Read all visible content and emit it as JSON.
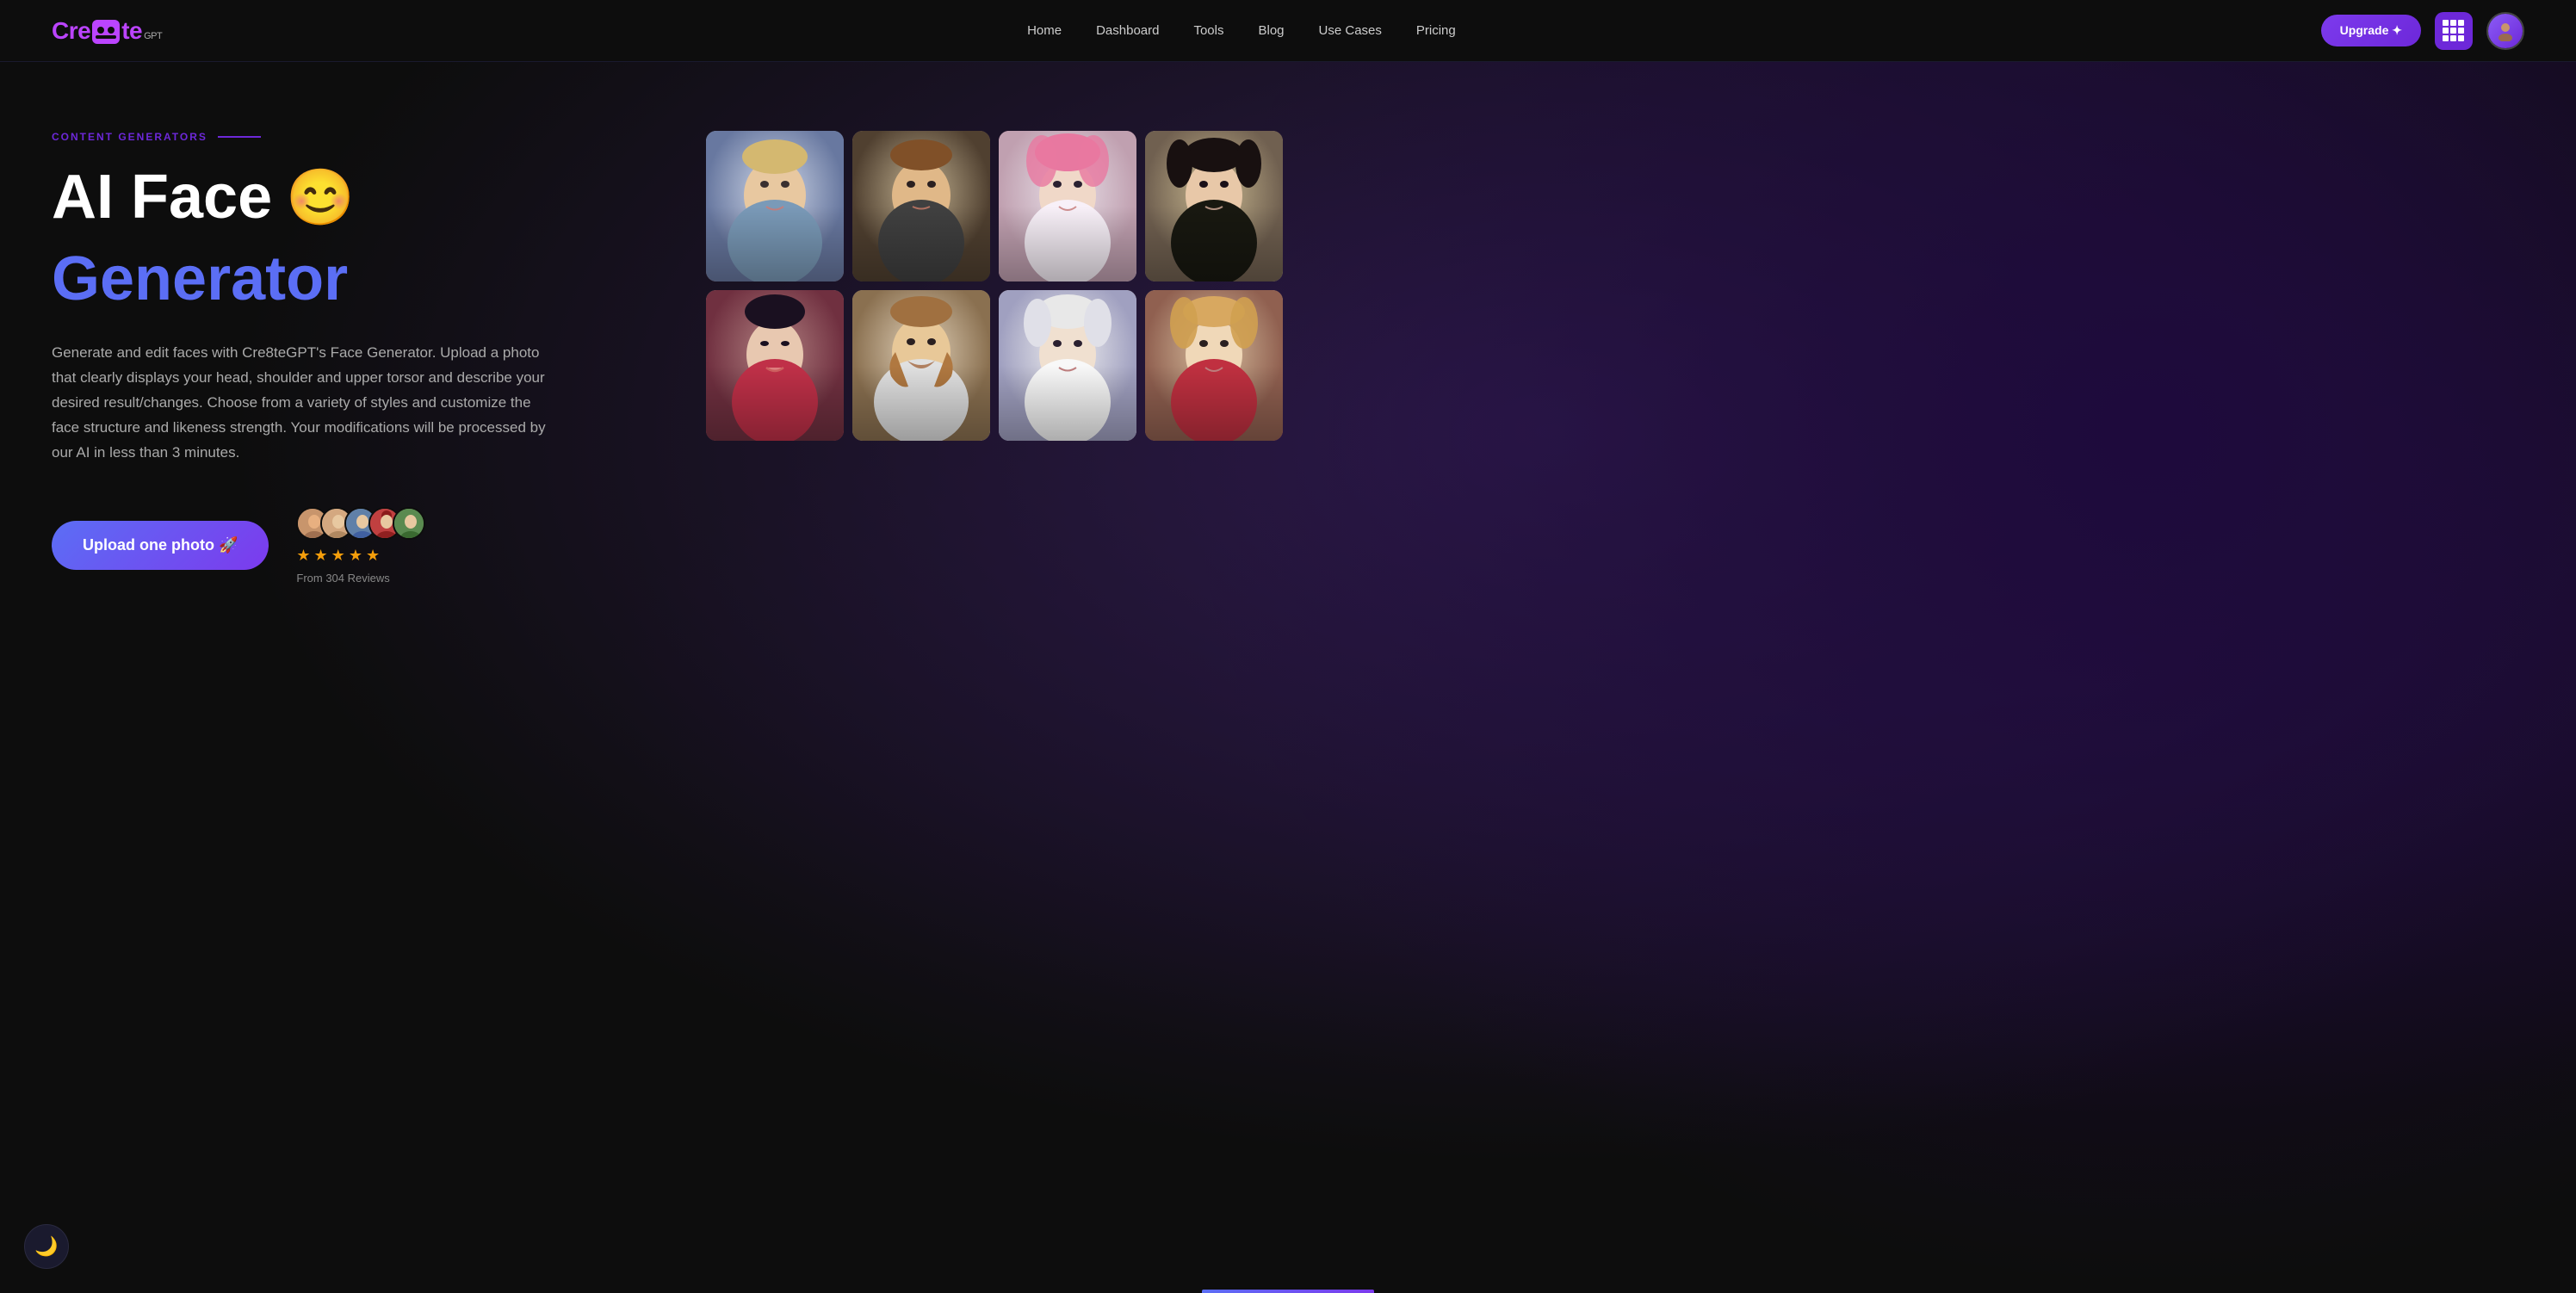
{
  "brand": {
    "name": "Cre8teGPT",
    "logo_text": "Cre8te",
    "logo_suffix": "GPT"
  },
  "navbar": {
    "links": [
      {
        "label": "Home",
        "href": "#"
      },
      {
        "label": "Dashboard",
        "href": "#"
      },
      {
        "label": "Tools",
        "href": "#"
      },
      {
        "label": "Blog",
        "href": "#"
      },
      {
        "label": "Use Cases",
        "href": "#"
      },
      {
        "label": "Pricing",
        "href": "#"
      }
    ],
    "upgrade_label": "Upgrade ✦"
  },
  "hero": {
    "tag": "CONTENT GENERATORS",
    "title_part1": "AI Face",
    "title_emoji": "😊",
    "title_part2": "Generator",
    "description": "Generate and edit faces with Cre8teGPT's Face Generator. Upload a photo that clearly displays your head, shoulder and upper torsor and describe your desired result/changes. Choose from a variety of styles and customize the face structure and likeness strength. Your modifications will be processed by our AI in less than 3 minutes.",
    "cta_button": "Upload one photo 🚀",
    "review_count_text": "From 304 Reviews",
    "stars": [
      "★",
      "★",
      "★",
      "★",
      "★"
    ]
  },
  "photo_grid": {
    "images": [
      {
        "id": "face-1",
        "alt": "Blonde woman portrait",
        "class": "face-1"
      },
      {
        "id": "face-2",
        "alt": "Brown hair man portrait",
        "class": "face-2"
      },
      {
        "id": "face-3",
        "alt": "Pink hair woman portrait",
        "class": "face-3"
      },
      {
        "id": "face-4",
        "alt": "Dark hair woman portrait",
        "class": "face-4"
      },
      {
        "id": "face-5",
        "alt": "Asian woman portrait",
        "class": "face-5"
      },
      {
        "id": "face-6",
        "alt": "Bearded man portrait",
        "class": "face-6"
      },
      {
        "id": "face-7",
        "alt": "Silver hair woman portrait",
        "class": "face-7"
      },
      {
        "id": "face-8",
        "alt": "Blonde woman red dress portrait",
        "class": "face-8"
      }
    ]
  },
  "dark_toggle": {
    "icon": "🌙"
  },
  "colors": {
    "accent_purple": "#7c3aed",
    "accent_blue": "#5b6ef5",
    "star_gold": "#f59e0b",
    "bg_dark": "#0d0d0d"
  }
}
